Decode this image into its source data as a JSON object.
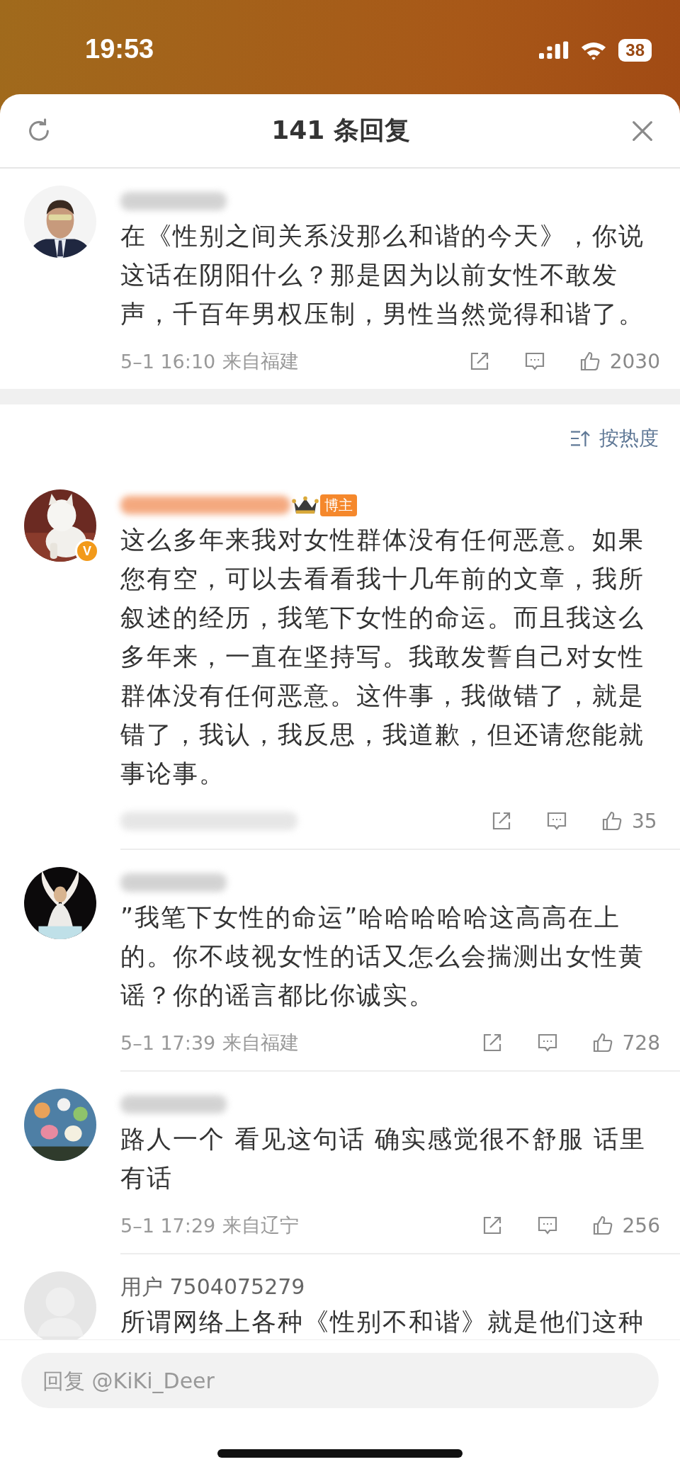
{
  "status_bar": {
    "time": "19:53",
    "battery": "38"
  },
  "header": {
    "title": "141 条回复"
  },
  "top_comment": {
    "author_hidden": true,
    "text": "在《性别之间关系没那么和谐的今天》，你说这话在阴阳什么？那是因为以前女性不敢发声，千百年男权压制，男性当然觉得和谐了。",
    "date": "5–1 16:10",
    "location": "来自福建",
    "likes": "2030"
  },
  "sort": {
    "label": "按热度"
  },
  "comments": [
    {
      "author_hidden": true,
      "role": "博主",
      "avatar": {
        "kind": "picture",
        "verified": "V"
      },
      "text": "这么多年来我对女性群体没有任何恶意。如果您有空，可以去看看我十几年前的文章，我所叙述的经历，我笔下女性的命运。而且我这么多年来，一直在坚持写。我敢发誓自己对女性群体没有任何恶意。这件事，我做错了，就是错了，我认，我反思，我道歉，但还请您能就事论事。",
      "meta_hidden": true,
      "likes": "35"
    },
    {
      "author_hidden": true,
      "text": "”我笔下女性的命运”哈哈哈哈哈这高高在上的。你不歧视女性的话又怎么会揣测出女性黄谣？你的谣言都比你诚实。",
      "date": "5–1 17:39",
      "location": "来自福建",
      "likes": "728"
    },
    {
      "author_hidden": true,
      "text": "路人一个 看见这句话 确实感觉很不舒服 话里有话",
      "date": "5–1 17:29",
      "location": "来自辽宁",
      "likes": "256"
    },
    {
      "author": "用户 7504075279",
      "avatar": {
        "kind": "default"
      },
      "text": "所谓网络上各种《性别不和谐》就是他们这种"
    }
  ],
  "reply_field": {
    "placeholder": "回复 @KiKi_Deer"
  }
}
